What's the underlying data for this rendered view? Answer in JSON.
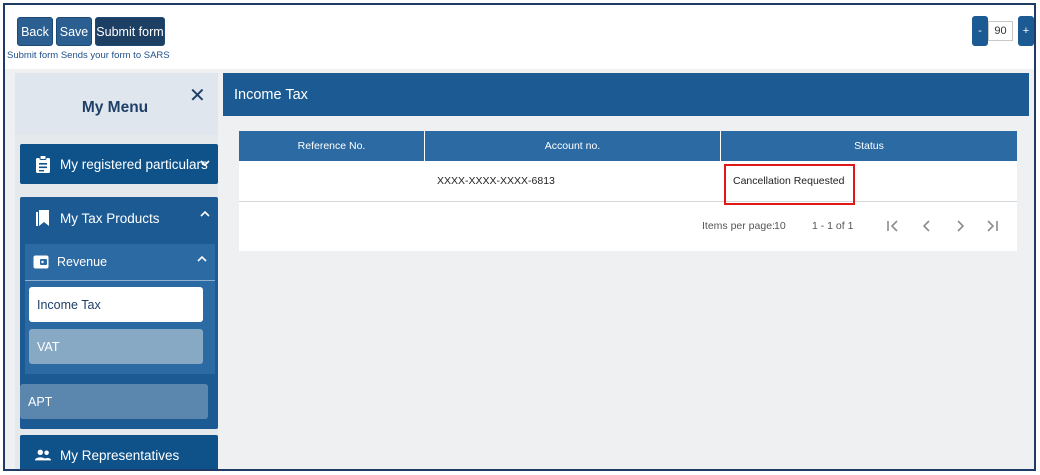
{
  "toolbar": {
    "back_label": "Back",
    "save_label": "Save",
    "submit_label": "Submit form",
    "hint": "Submit form Sends your form to SARS",
    "zoom": {
      "minus": "-",
      "value": "90",
      "plus": "+"
    }
  },
  "sidebar": {
    "title": "My Menu",
    "close": "✕",
    "items": [
      {
        "label": "My registered particulars",
        "icon": "clipboard-icon"
      },
      {
        "label": "My Tax Products",
        "icon": "bookmark-icon"
      },
      {
        "label": "My Representatives",
        "icon": "people-icon"
      }
    ],
    "revenue": {
      "label": "Revenue",
      "icon": "wallet-icon"
    },
    "subitems": [
      "Income Tax",
      "VAT"
    ],
    "apt": "APT"
  },
  "main": {
    "title": "Income Tax",
    "table": {
      "headers": [
        "Reference No.",
        "Account no.",
        "Status"
      ],
      "rows": [
        {
          "reference": "",
          "account": "XXXX-XXXX-XXXX-6813",
          "status": "Cancellation Requested"
        }
      ]
    },
    "pager": {
      "items_per_page_label": "Items per page:",
      "items_per_page": "10",
      "range": "1 - 1 of 1"
    }
  },
  "colors": {
    "primary": "#1b5a93",
    "dark": "#0f528a",
    "highlight": "#e01818"
  }
}
